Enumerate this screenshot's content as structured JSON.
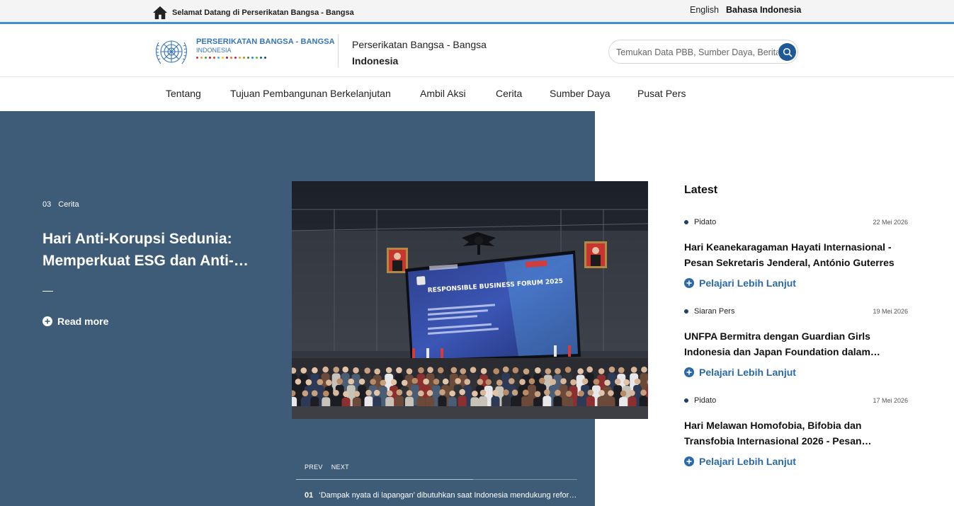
{
  "topbar": {
    "welcome": "Selamat Datang di Perserikatan Bangsa - Bangsa",
    "languages": [
      "English",
      "Bahasa Indonesia"
    ]
  },
  "header": {
    "logo_title": "PERSERIKATAN BANGSA - BANGSA",
    "logo_sub": "INDONESIA",
    "site_title_line1": "Perserikatan Bangsa - Bangsa",
    "site_title_line2": "Indonesia",
    "search_placeholder": "Temukan Data PBB, Sumber Daya, Berita"
  },
  "nav": [
    "Tentang",
    "Tujuan Pembangunan Berkelanjutan",
    "Ambil Aksi",
    "Cerita",
    "Sumber Daya",
    "Pusat Pers"
  ],
  "hero": {
    "index": "03",
    "category": "Cerita",
    "title": "Hari Anti-Korupsi Sedunia: Memperkuat ESG dan Anti-…",
    "read_more": "Read more",
    "prev": "PREV",
    "next": "NEXT",
    "bottom_index": "01",
    "bottom_story": "‘Dampak nyata di lapangan’ dibutuhkan saat Indonesia mendukung reformasi"
  },
  "photo": {
    "screen_title": "RESPONSIBLE BUSINESS FORUM 2025",
    "screen_sub": "Anti-Corruption at the Heart of ESG: Driving Sustainable Development and Impact Investment"
  },
  "latest": {
    "heading": "Latest",
    "items": [
      {
        "category": "Pidato",
        "date": "22 Mei 2026",
        "headline": "Hari Keanekaragaman Hayati Internasional - Pesan Sekretaris Jenderal, António Guterres",
        "link": "Pelajari Lebih Lanjut"
      },
      {
        "category": "Siaran Pers",
        "date": "19 Mei 2026",
        "headline": "UNFPA Bermitra dengan Guardian Girls Indonesia dan Japan Foundation dalam…",
        "link": "Pelajari Lebih Lanjut"
      },
      {
        "category": "Pidato",
        "date": "17 Mei 2026",
        "headline": "Hari Melawan Homofobia, Bifobia dan Transfobia Internasional 2026 - Pesan…",
        "link": "Pelajari Lebih Lanjut"
      }
    ]
  },
  "colors": {
    "accent_blue": "#3f8fd6",
    "hero_bg": "#3e5b78",
    "link_blue": "#2b6aa6",
    "logo_blue": "#3674b8"
  }
}
